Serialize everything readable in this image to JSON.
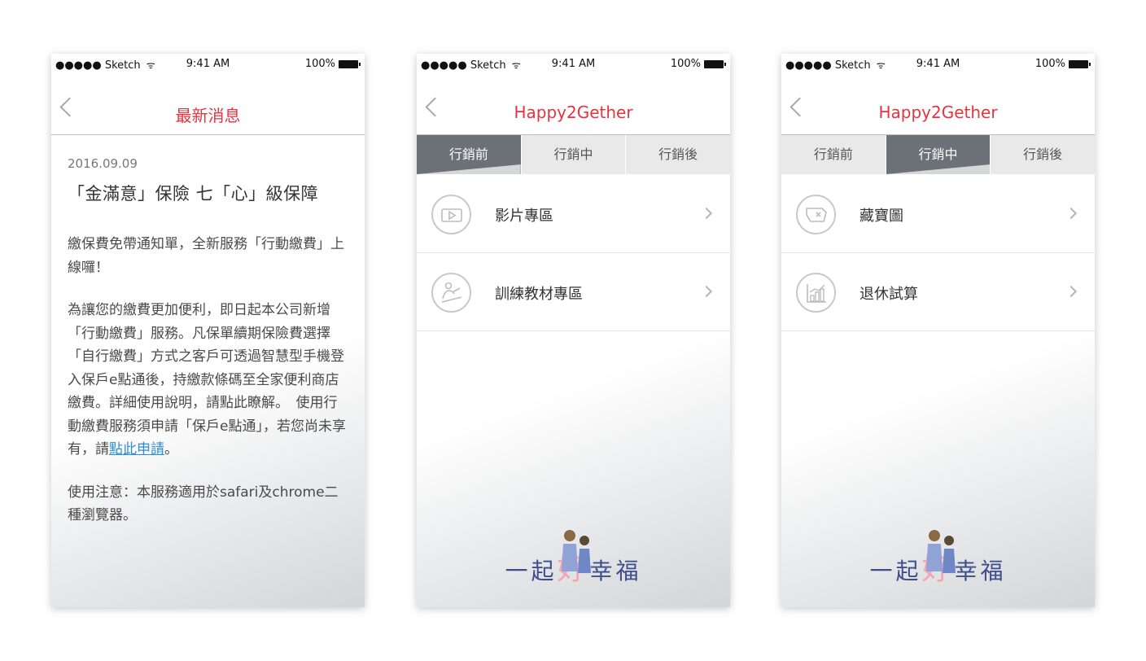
{
  "status": {
    "carrier": "●●●●● Sketch",
    "time": "9:41 AM",
    "battery": "100%"
  },
  "screen1": {
    "title": "最新消息",
    "date": "2016.09.09",
    "headline": "「金滿意」保險 七「心」級保障",
    "para1": "繳保費免帶通知單，全新服務「行動繳費」上線囉！",
    "para2_text": "為讓您的繳費更加便利，即日起本公司新增「行動繳費」服務。凡保單續期保險費選擇「自行繳費」方式之客戶可透過智慧型手機登入保戶e點通後，持繳款條碼至全家便利商店繳費。詳細使用說明，請點此瞭解。　使用行動繳費服務須申請「保戶e點通」，若您尚未享有，請",
    "para2_link": "點此申請",
    "para2_end": "。",
    "para3": "使用注意：本服務適用於safari及chrome二種瀏覽器。"
  },
  "screen2": {
    "title": "Happy2Gether",
    "tabs": [
      "行銷前",
      "行銷中",
      "行銷後"
    ],
    "items": [
      {
        "label": "影片專區",
        "icon": "video-icon"
      },
      {
        "label": "訓練教材專區",
        "icon": "training-icon"
      }
    ]
  },
  "screen3": {
    "title": "Happy2Gether",
    "tabs": [
      "行銷前",
      "行銷中",
      "行銷後"
    ],
    "items": [
      {
        "label": "藏寶圖",
        "icon": "treasure-map-icon"
      },
      {
        "label": "退休試算",
        "icon": "chart-icon"
      }
    ]
  },
  "logo": {
    "part1": "一起",
    "part2": "好",
    "part3": "幸福"
  },
  "colors": {
    "accent": "#e5343f",
    "tab_active": "#6c7177",
    "link": "#2e8fd1"
  }
}
